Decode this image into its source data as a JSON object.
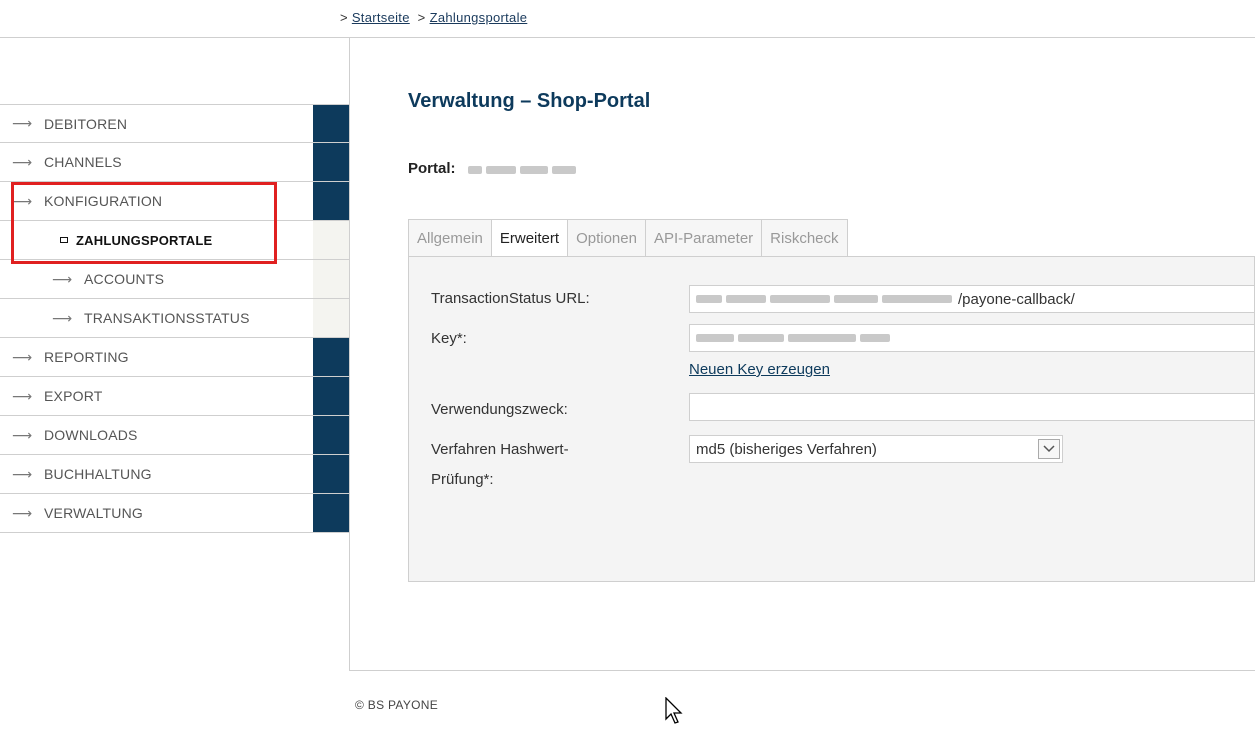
{
  "breadcrumb": {
    "prefix": ">",
    "separator": ">",
    "items": [
      "Startseite",
      "Zahlungsportale"
    ]
  },
  "sidebar": {
    "items": [
      {
        "label": "DEBITOREN",
        "icon": "arrow-right-icon"
      },
      {
        "label": "CHANNELS",
        "icon": "arrow-right-icon"
      },
      {
        "label": "KONFIGURATION",
        "icon": "arrow-right-icon"
      },
      {
        "label": "ZAHLUNGSPORTALE",
        "icon": "square-bullet-icon",
        "active": true
      },
      {
        "label": "ACCOUNTS",
        "icon": "arrow-right-icon"
      },
      {
        "label": "TRANSAKTIONSSTATUS",
        "icon": "arrow-right-icon"
      },
      {
        "label": "REPORTING",
        "icon": "arrow-right-icon"
      },
      {
        "label": "EXPORT",
        "icon": "arrow-right-icon"
      },
      {
        "label": "DOWNLOADS",
        "icon": "arrow-right-icon"
      },
      {
        "label": "BUCHHALTUNG",
        "icon": "arrow-right-icon"
      },
      {
        "label": "VERWALTUNG",
        "icon": "arrow-right-icon"
      }
    ]
  },
  "page": {
    "title": "Verwaltung – Shop-Portal",
    "portal_label": "Portal:"
  },
  "tabs": [
    {
      "label": "Allgemein"
    },
    {
      "label": "Erweitert",
      "active": true
    },
    {
      "label": "Optionen"
    },
    {
      "label": "API-Parameter"
    },
    {
      "label": "Riskcheck"
    }
  ],
  "form": {
    "transaction_status_label": "TransactionStatus URL:",
    "transaction_status_value_suffix": "/payone-callback/",
    "key_label": "Key*:",
    "new_key_link": "Neuen Key erzeugen",
    "verwendungszweck_label": "Verwendungszweck:",
    "verwendungszweck_value": "",
    "hash_label_line1": "Verfahren Hashwert-",
    "hash_label_line2": "Prüfung*:",
    "hash_selected": "md5 (bisheriges Verfahren)"
  },
  "footer": {
    "copyright": "© BS PAYONE"
  },
  "colors": {
    "navy": "#0d3a5c",
    "highlight_red": "#e02020",
    "panel_bg": "#f4f4f4"
  }
}
